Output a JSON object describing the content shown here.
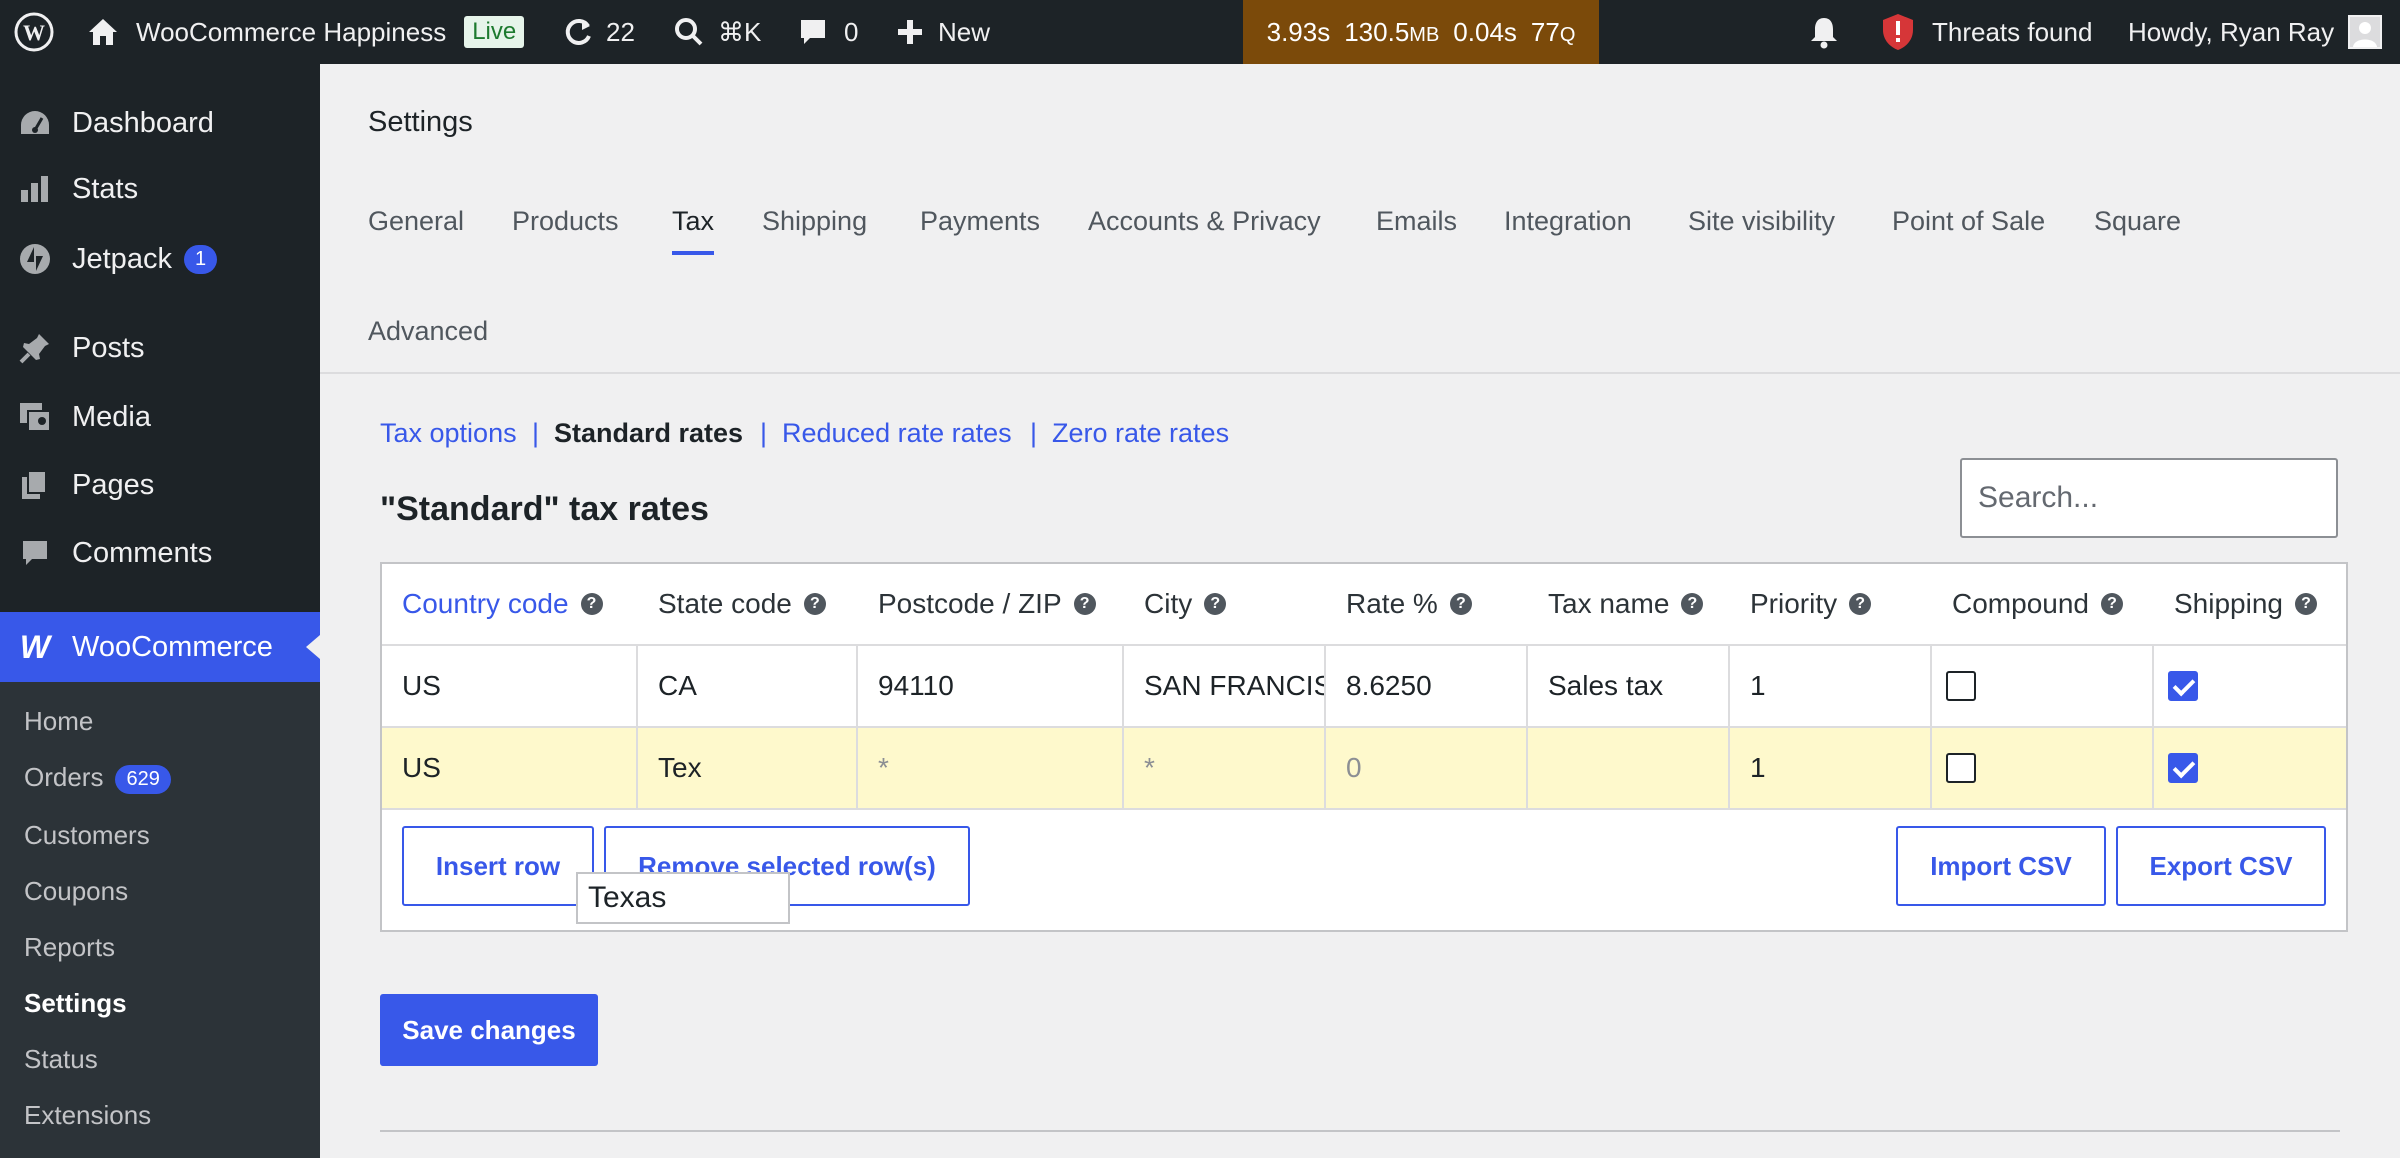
{
  "admin_bar": {
    "site_name": "WooCommerce Happiness",
    "live_label": "Live",
    "updates_count": "22",
    "search_shortcut": "⌘K",
    "comments_count": "0",
    "new_label": "New",
    "perf": {
      "time": "3.93s",
      "memory": "130.5",
      "memory_unit": "MB",
      "db_time": "0.04s",
      "queries": "77",
      "queries_unit": "Q"
    },
    "threats_label": "Threats found",
    "greeting": "Howdy, Ryan Ray"
  },
  "sidebar": {
    "items": [
      {
        "label": "Dashboard",
        "icon": "dashboard-icon"
      },
      {
        "label": "Stats",
        "icon": "stats-icon"
      },
      {
        "label": "Jetpack",
        "icon": "jetpack-icon",
        "badge": "1"
      },
      {
        "label": "Posts",
        "icon": "pin-icon"
      },
      {
        "label": "Media",
        "icon": "media-icon"
      },
      {
        "label": "Pages",
        "icon": "pages-icon"
      },
      {
        "label": "Comments",
        "icon": "comment-icon"
      }
    ],
    "woocommerce": {
      "label": "WooCommerce",
      "icon": "woo-icon"
    },
    "submenu": [
      {
        "label": "Home"
      },
      {
        "label": "Orders",
        "badge": "629"
      },
      {
        "label": "Customers"
      },
      {
        "label": "Coupons"
      },
      {
        "label": "Reports"
      },
      {
        "label": "Settings",
        "current": true
      },
      {
        "label": "Status"
      },
      {
        "label": "Extensions"
      }
    ]
  },
  "page": {
    "title": "Settings",
    "tabs": [
      "General",
      "Products",
      "Tax",
      "Shipping",
      "Payments",
      "Accounts & Privacy",
      "Emails",
      "Integration",
      "Site visibility",
      "Point of Sale",
      "Square",
      "Advanced"
    ],
    "active_tab": "Tax",
    "subsections": [
      "Tax options",
      "Standard rates",
      "Reduced rate rates",
      "Zero rate rates"
    ],
    "separator": "|",
    "section_title": "\"Standard\" tax rates",
    "search_placeholder": "Search..."
  },
  "table": {
    "columns": [
      "Country code",
      "State code",
      "Postcode / ZIP",
      "City",
      "Rate %",
      "Tax name",
      "Priority",
      "Compound",
      "Shipping"
    ],
    "rows": [
      {
        "country": "US",
        "state": "CA",
        "postcode": "94110",
        "city": "SAN FRANCISCO",
        "rate": "8.6250",
        "name": "Sales tax",
        "priority": "1",
        "compound": false,
        "shipping": true
      },
      {
        "country": "US",
        "state": "Tex",
        "postcode": "*",
        "city": "*",
        "rate": "0",
        "name": "",
        "priority": "1",
        "compound": false,
        "shipping": true
      }
    ],
    "autocomplete_suggestion": "Texas",
    "buttons": {
      "insert": "Insert row",
      "remove": "Remove selected row(s)",
      "import": "Import CSV",
      "export": "Export CSV"
    }
  },
  "save_label": "Save changes",
  "colors": {
    "accent": "#3858e9",
    "admin_bar": "#1d2327",
    "perf_bg": "#7b4a0a",
    "selected_row": "#fef9cc"
  }
}
